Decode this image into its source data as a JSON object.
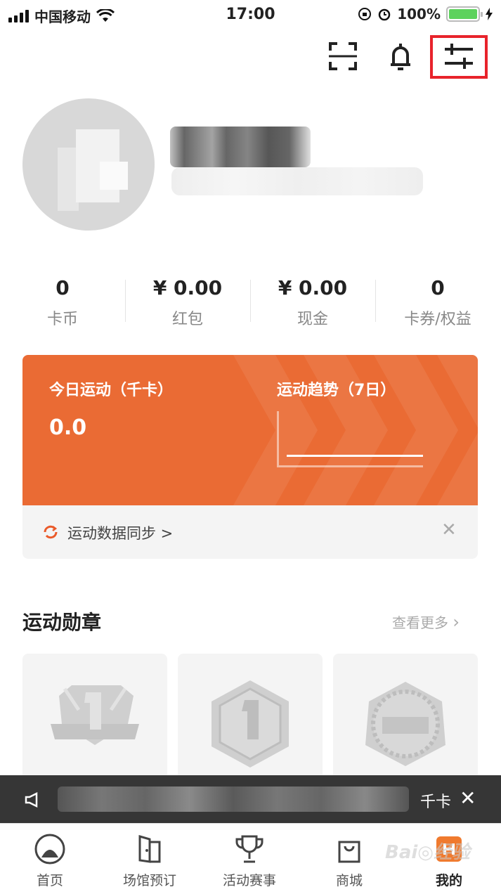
{
  "status_bar": {
    "carrier": "中国移动",
    "time": "17:00",
    "battery": "100%"
  },
  "stats": [
    {
      "value": "0",
      "label": "卡币"
    },
    {
      "value": "¥ 0.00",
      "label": "红包"
    },
    {
      "value": "¥ 0.00",
      "label": "现金"
    },
    {
      "value": "0",
      "label": "卡券/权益"
    }
  ],
  "card": {
    "today_title": "今日运动（千卡）",
    "today_value": "0.0",
    "trend_title": "运动趋势（7日）",
    "sync_label": "运动数据同步 >"
  },
  "badges": {
    "title": "运动勋章",
    "more": "查看更多"
  },
  "toast": {
    "suffix": "千卡"
  },
  "tabs": [
    {
      "label": "首页"
    },
    {
      "label": "场馆预订"
    },
    {
      "label": "活动赛事"
    },
    {
      "label": "商城"
    },
    {
      "label": "我的"
    }
  ],
  "colors": {
    "accent": "#ea6b34",
    "highlight_box": "#e8232b"
  }
}
